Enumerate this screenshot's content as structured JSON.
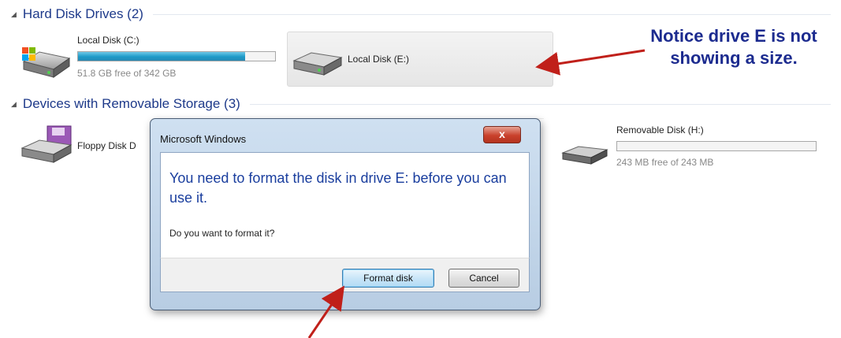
{
  "sections": {
    "hard_disk_drives": "Hard Disk Drives (2)",
    "removable_storage": "Devices with Removable Storage (3)"
  },
  "drives": {
    "c": {
      "name": "Local Disk (C:)",
      "free": "51.8 GB free of 342 GB",
      "used_fraction": 0.849
    },
    "e": {
      "name": "Local Disk (E:)"
    },
    "floppy": {
      "name": "Floppy Disk D"
    },
    "h": {
      "name": "Removable Disk (H:)",
      "free": "243 MB free of 243 MB",
      "used_fraction": 0.0
    }
  },
  "annotation": {
    "line1": "Notice drive E is not",
    "line2": "showing a size."
  },
  "dialog": {
    "title": "Microsoft Windows",
    "close_label": "x",
    "message": "You need to format the disk in drive E: before you can use it.",
    "question": "Do you want to format it?",
    "format_label": "Format disk",
    "cancel_label": "Cancel"
  },
  "colors": {
    "header_text": "#1e3a8a",
    "annotation_text": "#1c2b8f",
    "arrow": "#c0201a",
    "progress_fill": "#1c9ac8"
  }
}
